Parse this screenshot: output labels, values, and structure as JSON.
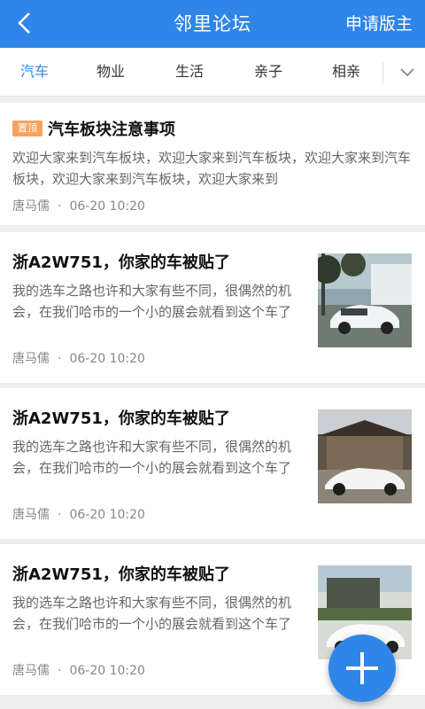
{
  "header": {
    "title": "邻里论坛",
    "action_label": "申请版主"
  },
  "tabs": [
    "汽车",
    "物业",
    "生活",
    "亲子",
    "相亲"
  ],
  "pinned": {
    "badge": "置顶",
    "title": "汽车板块注意事项",
    "body": "欢迎大家来到汽车板块，欢迎大家来到汽车板块，欢迎大家来到汽车板块，欢迎大家来到汽车板块，欢迎大家来到",
    "author": "唐马儒",
    "separator": "·",
    "time": "06-20 10:20"
  },
  "posts": [
    {
      "title": "浙A2W751，你家的车被贴了",
      "body": "我的选车之路也许和大家有些不同，很偶然的机会，在我们哈市的一个小的展会就看到这个车了",
      "author": "唐马儒",
      "separator": "·",
      "time": "06-20 10:20"
    },
    {
      "title": "浙A2W751，你家的车被贴了",
      "body": "我的选车之路也许和大家有些不同，很偶然的机会，在我们哈市的一个小的展会就看到这个车了",
      "author": "唐马儒",
      "separator": "·",
      "time": "06-20 10:20"
    },
    {
      "title": "浙A2W751，你家的车被贴了",
      "body": "我的选车之路也许和大家有些不同，很偶然的机会，在我们哈市的一个小的展会就看到这个车了",
      "author": "唐马儒",
      "separator": "·",
      "time": "06-20 10:20"
    }
  ],
  "icons": {
    "back": "chevron-left-icon",
    "more": "chevron-down-icon",
    "fab": "plus-icon"
  },
  "colors": {
    "primary": "#2f86e8",
    "badge": "#f7a35c"
  }
}
